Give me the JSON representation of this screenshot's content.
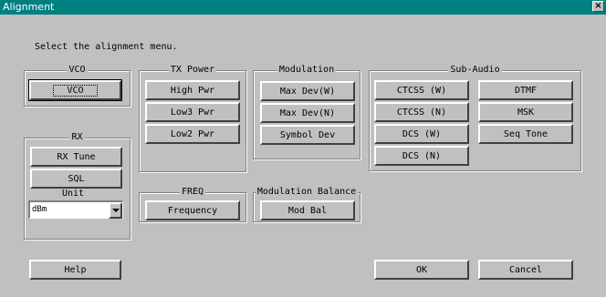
{
  "window": {
    "title": "Alignment",
    "close_label": "×"
  },
  "prompt": "Select the alignment menu.",
  "vco": {
    "legend": "VCO",
    "button": "VCO"
  },
  "tx_power": {
    "legend": "TX Power",
    "buttons": [
      "High Pwr",
      "Low3 Pwr",
      "Low2 Pwr"
    ]
  },
  "modulation": {
    "legend": "Modulation",
    "buttons": [
      "Max Dev(W)",
      "Max Dev(N)",
      "Symbol Dev"
    ]
  },
  "sub_audio": {
    "legend": "Sub-Audio",
    "buttons": [
      "CTCSS (W)",
      "CTCSS (N)",
      "DCS (W)",
      "DCS (N)",
      "DTMF",
      "MSK",
      "Seq Tone"
    ]
  },
  "rx": {
    "legend": "RX",
    "buttons": [
      "RX Tune",
      "SQL"
    ],
    "unit_label": "Unit",
    "unit_value": "dBm"
  },
  "freq": {
    "legend": "FREQ",
    "button": "Frequency"
  },
  "mod_balance": {
    "legend": "Modulation Balance",
    "button": "Mod Bal"
  },
  "footer": {
    "help": "Help",
    "ok": "OK",
    "cancel": "Cancel"
  }
}
